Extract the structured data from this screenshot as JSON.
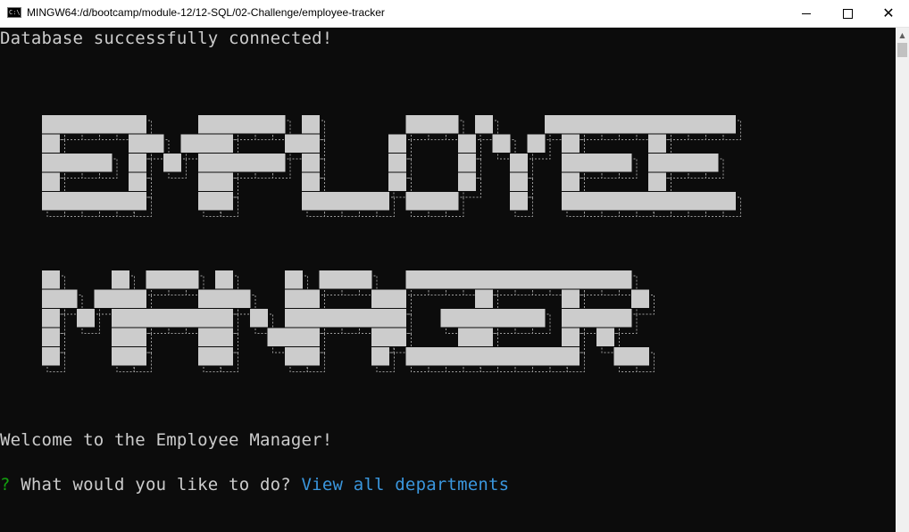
{
  "window": {
    "icon_label": "C:\\",
    "title": "MINGW64:/d/bootcamp/module-12/12-SQL/02-Challenge/employee-tracker",
    "minimize_glyph": "—",
    "maximize_glyph": "☐",
    "close_glyph": "✕"
  },
  "terminal": {
    "connected_message": "Database successfully connected!",
    "banner_lines": [
      "EMPLOYEE",
      "MANAGER"
    ],
    "welcome_message": "Welcome to the Employee Manager!",
    "prompt_marker": "?",
    "prompt_question": "What would you like to do?",
    "selected_answer": "View all departments"
  },
  "colors": {
    "background": "#0c0c0c",
    "text": "#cccccc",
    "prompt_marker": "#13a10e",
    "answer": "#3a96dd",
    "banner_fill": "#cccccc"
  }
}
